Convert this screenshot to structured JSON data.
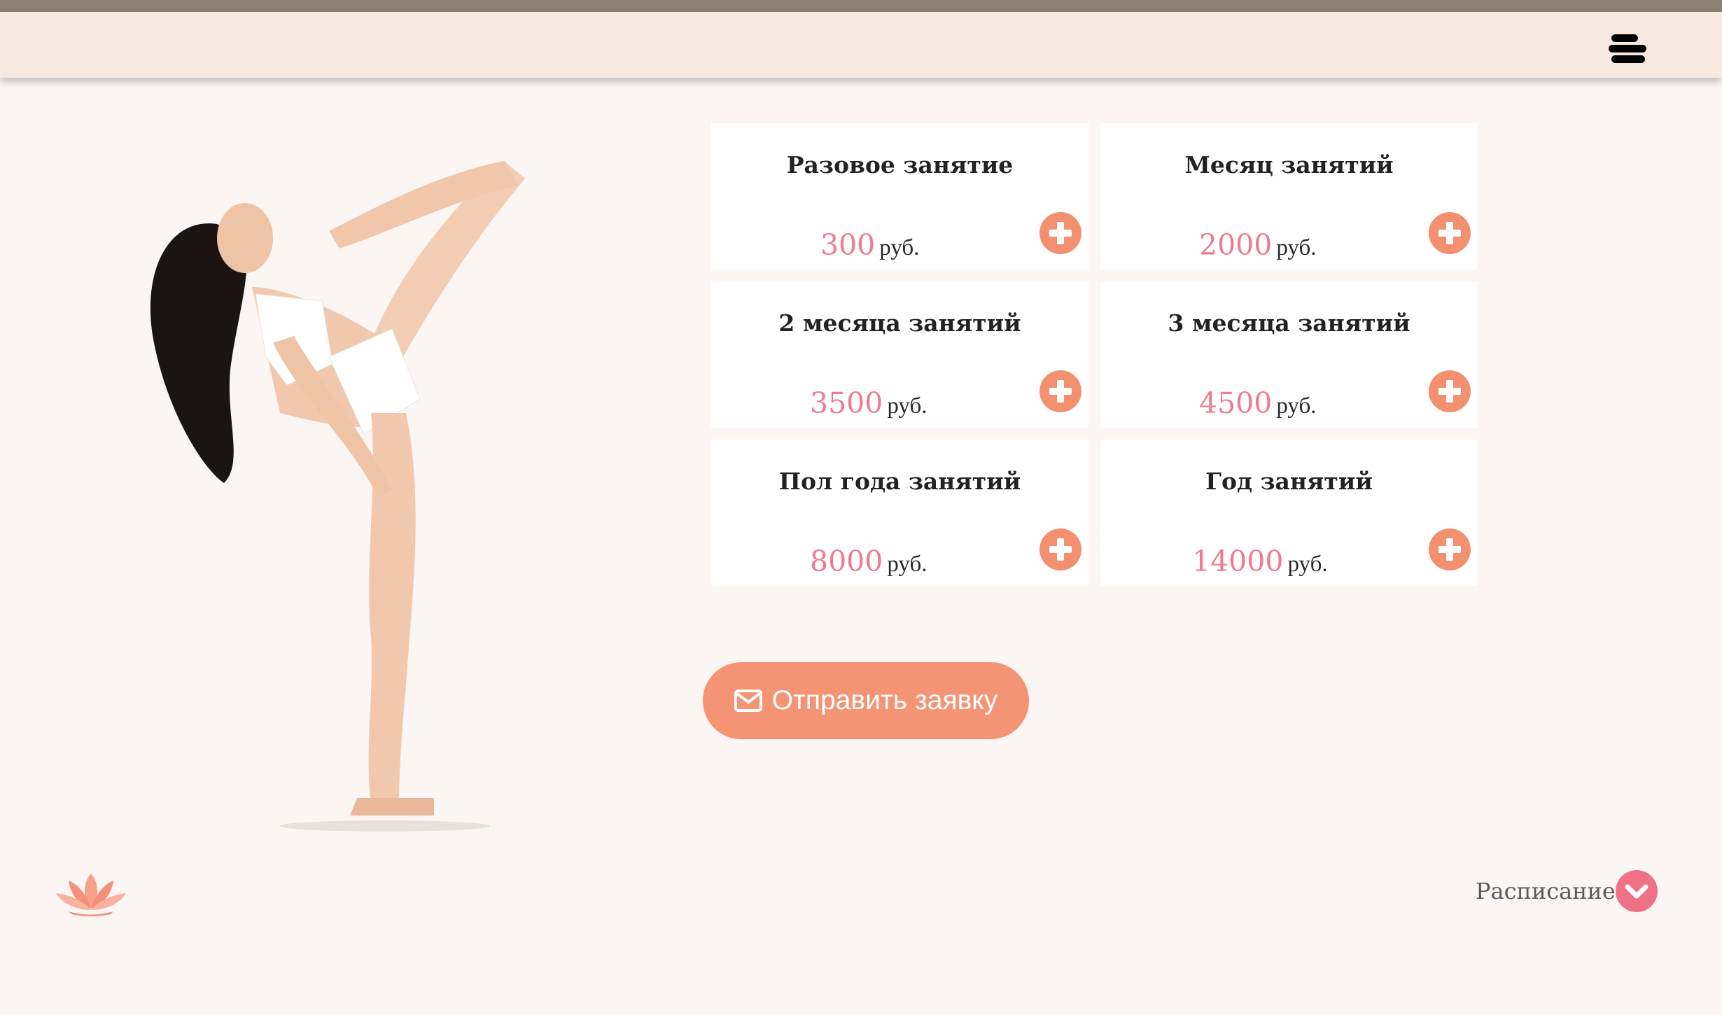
{
  "header": {
    "menu_icon": "hamburger-menu-icon"
  },
  "plans": [
    {
      "title": "Разовое занятие",
      "amount": "300",
      "currency": "руб."
    },
    {
      "title": "Месяц занятий",
      "amount": "2000",
      "currency": "руб."
    },
    {
      "title": "2 месяца занятий",
      "amount": "3500",
      "currency": "руб."
    },
    {
      "title": "3 месяца занятий",
      "amount": "4500",
      "currency": "руб."
    },
    {
      "title": "Пол года занятий",
      "amount": "8000",
      "currency": "руб."
    },
    {
      "title": "Год занятий",
      "amount": "14000",
      "currency": "руб."
    }
  ],
  "submit": {
    "label": "Отправить заявку",
    "icon": "envelope-icon"
  },
  "footer": {
    "schedule_label": "Расписание",
    "schedule_icon": "chevron-down-icon",
    "logo_icon": "lotus-icon"
  },
  "colors": {
    "accent": "#f59474",
    "price": "#ef7a92",
    "header_bg": "#f8e9e0",
    "page_bg": "#fbf5f3",
    "schedule_btn": "#ef7188"
  }
}
